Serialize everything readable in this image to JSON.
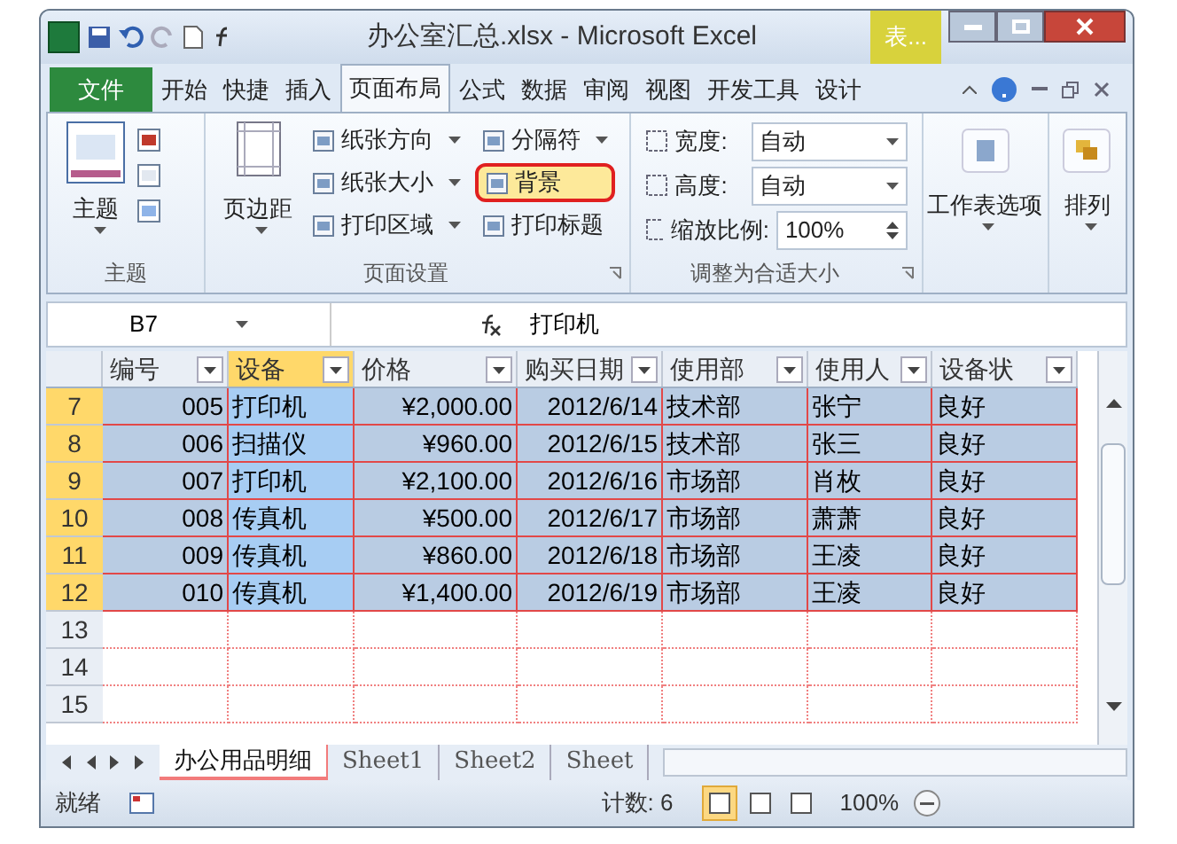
{
  "window": {
    "title": "办公室汇总.xlsx - Microsoft Excel",
    "contextual_tab": "表..."
  },
  "file_tab": "文件",
  "tabs": [
    {
      "label": "开始",
      "selected": false
    },
    {
      "label": "快捷",
      "selected": false
    },
    {
      "label": "插入",
      "selected": false
    },
    {
      "label": "页面布局",
      "selected": true
    },
    {
      "label": "公式",
      "selected": false
    },
    {
      "label": "数据",
      "selected": false
    },
    {
      "label": "审阅",
      "selected": false
    },
    {
      "label": "视图",
      "selected": false
    },
    {
      "label": "开发工具",
      "selected": false
    },
    {
      "label": "设计",
      "selected": false
    }
  ],
  "ribbon": {
    "theme_group": {
      "label": "主题",
      "button": "主题"
    },
    "page_setup": {
      "label": "页面设置",
      "margins": "页边距",
      "items": [
        {
          "label": "纸张方向",
          "dropdown": true,
          "highlighted": false
        },
        {
          "label": "分隔符",
          "dropdown": true,
          "highlighted": false
        },
        {
          "label": "纸张大小",
          "dropdown": true,
          "highlighted": false
        },
        {
          "label": "背景",
          "dropdown": false,
          "highlighted": true
        },
        {
          "label": "打印区域",
          "dropdown": true,
          "highlighted": false
        },
        {
          "label": "打印标题",
          "dropdown": false,
          "highlighted": false
        }
      ]
    },
    "scale": {
      "label": "调整为合适大小",
      "fields": [
        {
          "label": "宽度:",
          "value": "自动",
          "kind": "dropdown"
        },
        {
          "label": "高度:",
          "value": "自动",
          "kind": "dropdown"
        },
        {
          "label": "缩放比例:",
          "value": "100%",
          "kind": "spinner"
        }
      ]
    },
    "sheet_options": "工作表选项",
    "arrange": "排列"
  },
  "formula_bar": {
    "name_box": "B7",
    "value": "打印机"
  },
  "columns": [
    {
      "label": "编号",
      "selected": false
    },
    {
      "label": "设备",
      "selected": true
    },
    {
      "label": "价格",
      "selected": false
    },
    {
      "label": "购买日期",
      "selected": false
    },
    {
      "label": "使用部",
      "selected": false
    },
    {
      "label": "使用人",
      "selected": false
    },
    {
      "label": "设备状",
      "selected": false
    }
  ],
  "rows": [
    {
      "number": "7",
      "selected": true,
      "cells": [
        "005",
        "打印机",
        "¥2,000.00",
        "2012/6/14",
        "技术部",
        "张宁",
        "良好"
      ]
    },
    {
      "number": "8",
      "selected": true,
      "cells": [
        "006",
        "扫描仪",
        "¥960.00",
        "2012/6/15",
        "技术部",
        "张三",
        "良好"
      ]
    },
    {
      "number": "9",
      "selected": true,
      "cells": [
        "007",
        "打印机",
        "¥2,100.00",
        "2012/6/16",
        "市场部",
        "肖枚",
        "良好"
      ]
    },
    {
      "number": "10",
      "selected": true,
      "cells": [
        "008",
        "传真机",
        "¥500.00",
        "2012/6/17",
        "市场部",
        "萧萧",
        "良好"
      ]
    },
    {
      "number": "11",
      "selected": true,
      "cells": [
        "009",
        "传真机",
        "¥860.00",
        "2012/6/18",
        "市场部",
        "王凌",
        "良好"
      ]
    },
    {
      "number": "12",
      "selected": true,
      "cells": [
        "010",
        "传真机",
        "¥1,400.00",
        "2012/6/19",
        "市场部",
        "王凌",
        "良好"
      ]
    },
    {
      "number": "13",
      "selected": false,
      "cells": []
    },
    {
      "number": "14",
      "selected": false,
      "cells": []
    },
    {
      "number": "15",
      "selected": false,
      "cells": []
    }
  ],
  "sheet_tabs": [
    {
      "label": "办公用品明细",
      "selected": true
    },
    {
      "label": "Sheet1",
      "selected": false
    },
    {
      "label": "Sheet2",
      "selected": false
    },
    {
      "label": "Sheet",
      "selected": false
    }
  ],
  "status_bar": {
    "ready": "就绪",
    "count": "计数: 6",
    "views": [
      {
        "selected": true
      },
      {
        "selected": false
      },
      {
        "selected": false
      }
    ],
    "zoom": "100%"
  }
}
